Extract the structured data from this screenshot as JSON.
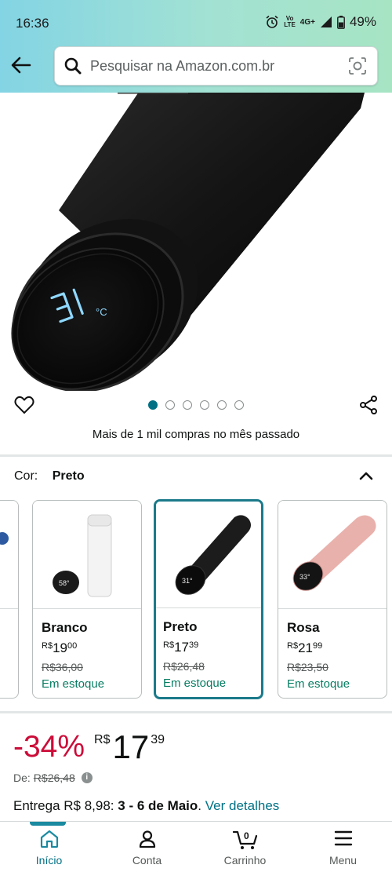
{
  "status_bar": {
    "time": "16:36",
    "volte_line1": "Vo",
    "volte_line2": "LTE",
    "network": "4G+",
    "battery": "49%"
  },
  "search": {
    "placeholder": "Pesquisar na Amazon.com.br"
  },
  "hero": {
    "display_temp": "31",
    "display_unit": "°C",
    "carousel_count": 6,
    "carousel_active": 0
  },
  "social_proof": "Mais de 1 mil compras no mês passado",
  "color": {
    "label": "Cor:",
    "selected": "Preto",
    "options": [
      {
        "name": "Branco",
        "currency": "R$",
        "whole": "19",
        "cents": "00",
        "old_price": "R$36,00",
        "stock": "Em estoque",
        "display": "58°"
      },
      {
        "name": "Preto",
        "currency": "R$",
        "whole": "17",
        "cents": "39",
        "old_price": "R$26,48",
        "stock": "Em estoque",
        "display": "31°"
      },
      {
        "name": "Rosa",
        "currency": "R$",
        "whole": "21",
        "cents": "99",
        "old_price": "R$23,50",
        "stock": "Em estoque",
        "display": "33°"
      }
    ]
  },
  "price": {
    "discount": "-34%",
    "currency": "R$",
    "whole": "17",
    "cents": "39",
    "from_label": "De:",
    "old_price": "R$26,48"
  },
  "delivery": {
    "prefix": "Entrega R$ 8,98: ",
    "dates": "3 - 6 de Maio",
    "separator": ".",
    "link": "Ver detalhes"
  },
  "nav": {
    "items": [
      {
        "label": "Início"
      },
      {
        "label": "Conta"
      },
      {
        "label": "Carrinho",
        "badge": "0"
      },
      {
        "label": "Menu"
      }
    ]
  },
  "colors": {
    "accent": "#007185",
    "discount": "#cc0c39",
    "in_stock": "#067d62",
    "header_start": "#83d4e4",
    "header_end": "#a7e4c4"
  }
}
